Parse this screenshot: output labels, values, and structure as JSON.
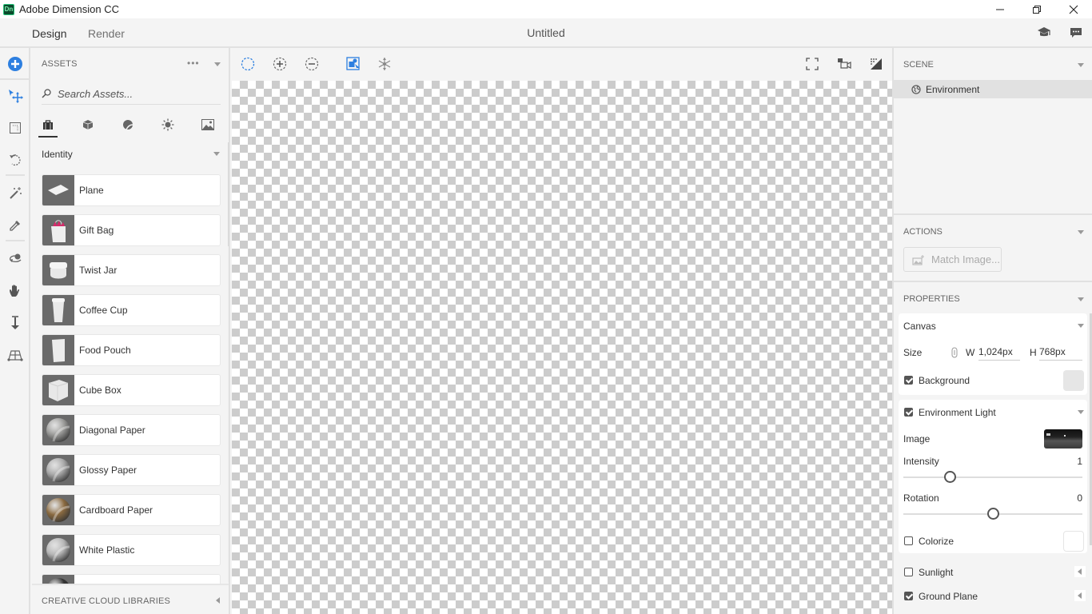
{
  "window": {
    "app_title": "Adobe Dimension CC",
    "logo_text": "Dn",
    "controls": {
      "minimize": "minimize-icon",
      "restore": "restore-icon",
      "close": "close-icon"
    }
  },
  "header": {
    "tabs": [
      {
        "label": "Design",
        "active": true
      },
      {
        "label": "Render",
        "active": false
      }
    ],
    "document_title": "Untitled",
    "icons": [
      "learn-icon",
      "feedback-icon"
    ]
  },
  "toolbar": {
    "tools": [
      {
        "name": "add-icon",
        "accent": "#2d7fe0"
      },
      {
        "name": "select-move-icon",
        "accent": "#2d7fe0"
      },
      {
        "name": "selection-box-icon"
      },
      {
        "name": "orbit-icon"
      },
      {
        "name": "magic-wand-icon"
      },
      {
        "name": "eyedropper-icon"
      },
      {
        "name": "orbit-camera-icon"
      },
      {
        "name": "pan-hand-icon"
      },
      {
        "name": "dolly-icon"
      },
      {
        "name": "horizon-icon"
      }
    ]
  },
  "assets": {
    "title": "ASSETS",
    "more_label": "•••",
    "search_placeholder": "Search Assets...",
    "categories": [
      {
        "icon": "bag-icon",
        "active": true
      },
      {
        "icon": "model-icon",
        "active": false
      },
      {
        "icon": "material-icon",
        "active": false
      },
      {
        "icon": "light-icon",
        "active": false
      },
      {
        "icon": "image-icon",
        "active": false
      }
    ],
    "group": "Identity",
    "items": [
      {
        "label": "Plane",
        "thumb": "plane"
      },
      {
        "label": "Gift Bag",
        "thumb": "giftbag"
      },
      {
        "label": "Twist Jar",
        "thumb": "jar"
      },
      {
        "label": "Coffee Cup",
        "thumb": "cup"
      },
      {
        "label": "Food Pouch",
        "thumb": "pouch"
      },
      {
        "label": "Cube Box",
        "thumb": "cube"
      },
      {
        "label": "Diagonal Paper",
        "thumb": "sphere-grey"
      },
      {
        "label": "Glossy Paper",
        "thumb": "sphere-glossy"
      },
      {
        "label": "Cardboard Paper",
        "thumb": "sphere-brown"
      },
      {
        "label": "White Plastic",
        "thumb": "sphere-white"
      },
      {
        "label": "",
        "thumb": "sphere-dark"
      }
    ],
    "cc_libraries": "CREATIVE CLOUD LIBRARIES"
  },
  "view_tools": {
    "left": [
      "select-area-icon",
      "zoom-in-icon",
      "zoom-out-icon",
      "frame-selection-icon",
      "snap-icon"
    ],
    "right": [
      "fit-canvas-icon",
      "camera-bookmark-icon",
      "render-preview-icon"
    ]
  },
  "scene": {
    "title": "SCENE",
    "items": [
      {
        "label": "Environment",
        "icon": "globe-icon",
        "selected": true
      }
    ]
  },
  "actions": {
    "title": "ACTIONS",
    "match_image": "Match Image..."
  },
  "properties": {
    "title": "PROPERTIES",
    "canvas": {
      "label": "Canvas",
      "size_label": "Size",
      "w_label": "W",
      "w_value": "1,024px",
      "h_label": "H",
      "h_value": "768px",
      "background_label": "Background",
      "background_checked": true,
      "background_color": "#e6e6e6"
    },
    "environment_light": {
      "label": "Environment Light",
      "checked": true,
      "image_label": "Image",
      "intensity_label": "Intensity",
      "intensity_value": "1",
      "intensity_fraction": 0.26,
      "rotation_label": "Rotation",
      "rotation_value": "0",
      "rotation_fraction": 0.5,
      "colorize_label": "Colorize",
      "colorize_checked": false,
      "colorize_color": "#ffffff"
    },
    "sunlight": {
      "label": "Sunlight",
      "checked": false
    },
    "ground_plane": {
      "label": "Ground Plane",
      "checked": true
    }
  }
}
